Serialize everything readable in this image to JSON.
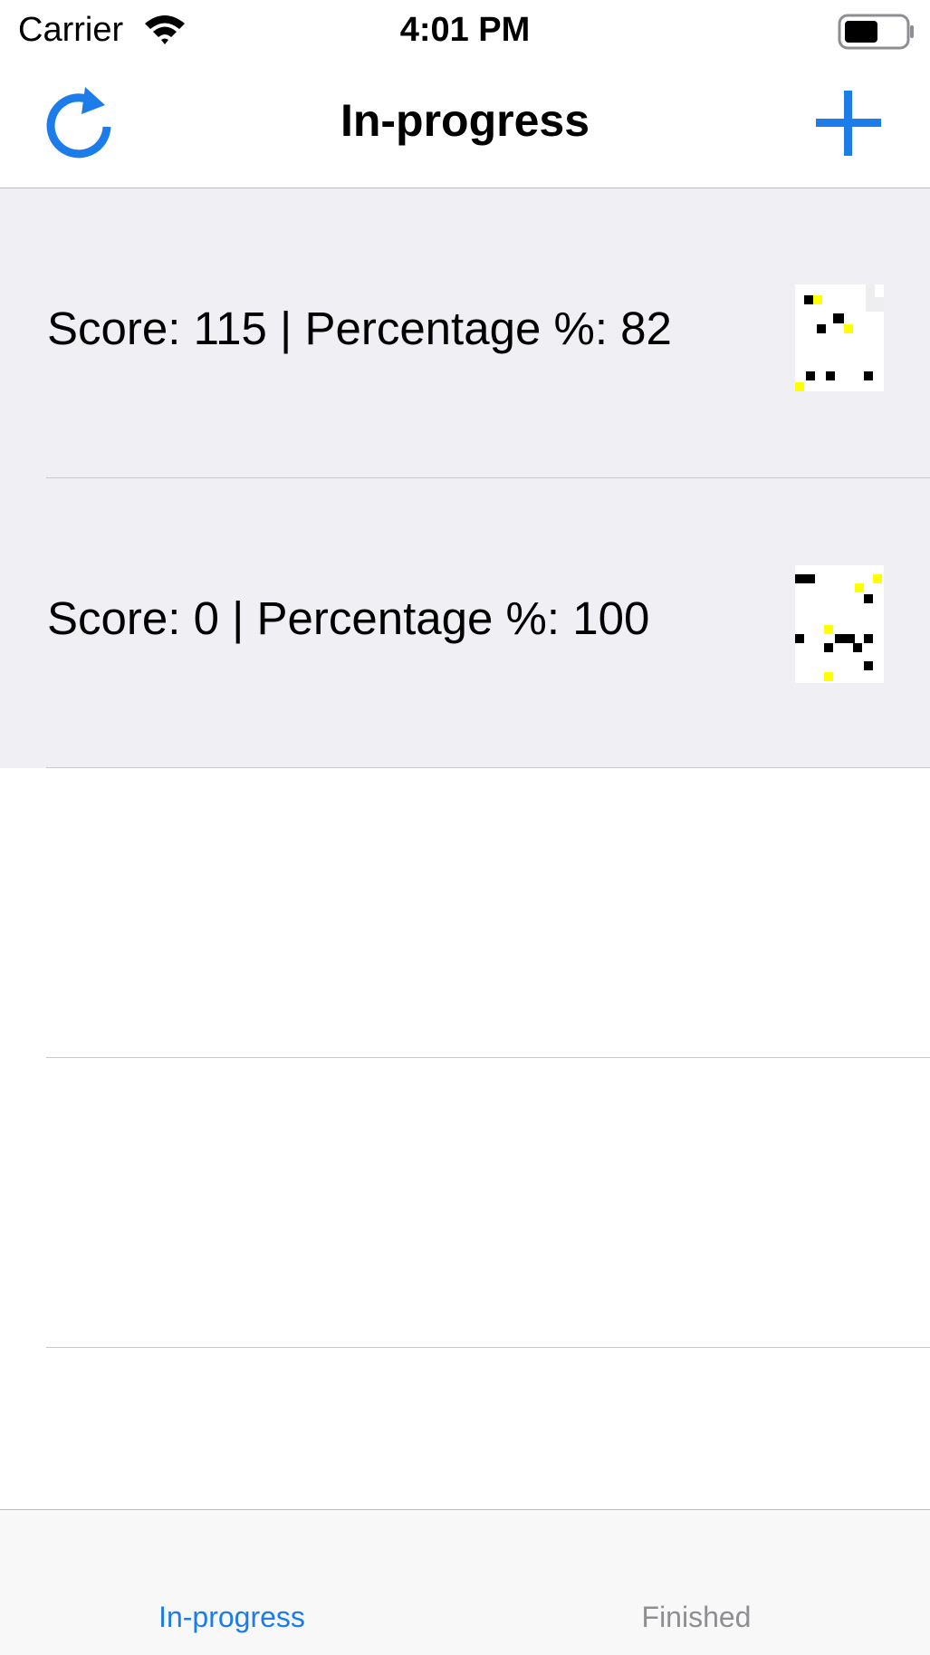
{
  "status_bar": {
    "carrier": "Carrier",
    "time": "4:01 PM",
    "icons": [
      "wifi-icon",
      "battery-icon"
    ]
  },
  "nav_bar": {
    "title": "In-progress",
    "left_icon": "refresh-icon",
    "right_icon": "plus-icon"
  },
  "games": [
    {
      "label": "Score: 115 | Percentage %: 82"
    },
    {
      "label": "Score: 0 | Percentage %: 100"
    }
  ],
  "tab_bar": {
    "tabs": [
      {
        "label": "In-progress",
        "selected": true
      },
      {
        "label": "Finished",
        "selected": false
      }
    ]
  },
  "colors": {
    "accent": "#1c7ce9",
    "cell_background": "#efeff4",
    "inactive_tab": "#8e8e93",
    "thumb_black": "#000000",
    "thumb_yellow": "#ffff00"
  }
}
